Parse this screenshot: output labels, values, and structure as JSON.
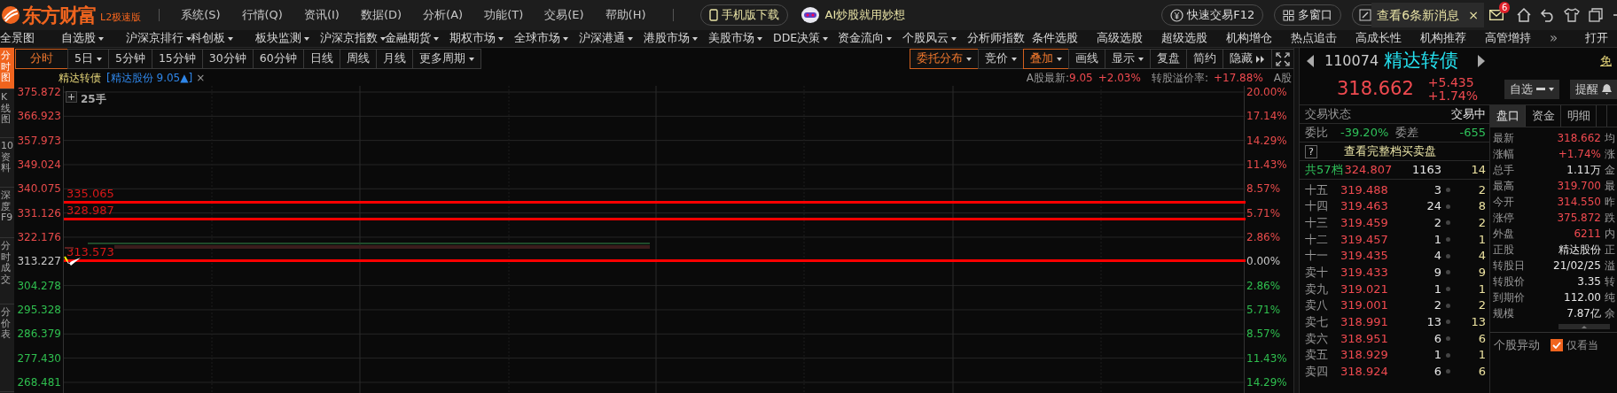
{
  "app": {
    "logo": "东方财富",
    "edition": "L2极速版"
  },
  "menu": [
    "系统(S)",
    "行情(Q)",
    "资讯(I)",
    "数据(D)",
    "分析(A)",
    "功能(T)",
    "交易(E)",
    "帮助(H)"
  ],
  "promo": {
    "download": "手机版下载",
    "ai": "AI炒股就用妙想"
  },
  "toolbar": {
    "quick_trade": "快速交易F12",
    "multi_window": "多窗口",
    "messages": "查看6条新消息",
    "close": "×",
    "mail_badge": "6"
  },
  "nav": [
    {
      "label": "全景图",
      "dropdown": false
    },
    {
      "label": "自选股",
      "dropdown": true
    },
    {
      "label": "沪深京排行",
      "dropdown": true
    },
    {
      "label": "科创板",
      "dropdown": true
    },
    {
      "label": "板块监测",
      "dropdown": true
    },
    {
      "label": "沪深京指数",
      "dropdown": true
    },
    {
      "label": "金融期货",
      "dropdown": true
    },
    {
      "label": "期权市场",
      "dropdown": true
    },
    {
      "label": "全球市场",
      "dropdown": true
    },
    {
      "label": "沪深港通",
      "dropdown": true
    },
    {
      "label": "港股市场",
      "dropdown": true
    },
    {
      "label": "美股市场",
      "dropdown": true
    },
    {
      "label": "DDE决策",
      "dropdown": true
    },
    {
      "label": "资金流向",
      "dropdown": true
    },
    {
      "label": "个股风云",
      "dropdown": true
    },
    {
      "label": "分析师指数",
      "dropdown": false
    },
    {
      "label": "条件选股",
      "dropdown": false
    },
    {
      "label": "高级选股",
      "dropdown": false
    },
    {
      "label": "超级选股",
      "dropdown": false
    },
    {
      "label": "机构增仓",
      "dropdown": false
    },
    {
      "label": "热点追击",
      "dropdown": false
    },
    {
      "label": "高成长性",
      "dropdown": false
    },
    {
      "label": "机构推荐",
      "dropdown": false
    },
    {
      "label": "高管增持",
      "dropdown": false
    }
  ],
  "nav_more": "»",
  "nav_right": "打开",
  "side_tabs": [
    {
      "label": "分时图",
      "selected": true
    },
    {
      "label": "K线图",
      "selected": false
    },
    {
      "label": "10资料",
      "selected": false
    },
    {
      "label": "深度F9",
      "selected": false
    },
    {
      "label": "分时成交",
      "selected": false
    },
    {
      "label": "分价表",
      "selected": false
    }
  ],
  "periods": [
    {
      "label": "分时",
      "selected": true,
      "dropdown": false
    },
    {
      "label": "5日",
      "selected": false,
      "dropdown": true
    },
    {
      "label": "5分钟",
      "selected": false,
      "dropdown": false
    },
    {
      "label": "15分钟",
      "selected": false,
      "dropdown": false
    },
    {
      "label": "30分钟",
      "selected": false,
      "dropdown": false
    },
    {
      "label": "60分钟",
      "selected": false,
      "dropdown": false
    },
    {
      "label": "日线",
      "selected": false,
      "dropdown": false
    },
    {
      "label": "周线",
      "selected": false,
      "dropdown": false
    },
    {
      "label": "月线",
      "selected": false,
      "dropdown": false
    },
    {
      "label": "更多周期",
      "selected": false,
      "dropdown": true
    }
  ],
  "tools": [
    {
      "label": "委托分布",
      "on": true,
      "dropdown": true
    },
    {
      "label": "竞价",
      "on": false,
      "dropdown": true
    },
    {
      "label": "叠加",
      "on": true,
      "dropdown": true
    },
    {
      "label": "画线",
      "on": false,
      "dropdown": false
    },
    {
      "label": "显示",
      "on": false,
      "dropdown": true
    },
    {
      "label": "复盘",
      "on": false,
      "dropdown": false
    },
    {
      "label": "简约",
      "on": false,
      "dropdown": false
    },
    {
      "label": "隐藏",
      "on": false,
      "dropdown": false,
      "kind": "hide"
    }
  ],
  "chart_header": {
    "name": "精达转债",
    "stock": "[精达股份 9.05▲]",
    "close": "×",
    "a_label": "A股最新:",
    "a_price": "9.05",
    "a_change": "+2.03%",
    "premium_label": "转股溢价率:",
    "premium": "+17.88%",
    "tail": "A股"
  },
  "volume_label": "25手",
  "axis_left": [
    {
      "label": "375.872",
      "kind": "up"
    },
    {
      "label": "366.923",
      "kind": "up"
    },
    {
      "label": "357.973",
      "kind": "up"
    },
    {
      "label": "349.024",
      "kind": "up"
    },
    {
      "label": "340.075",
      "kind": "up"
    },
    {
      "label": "331.126",
      "kind": "up"
    },
    {
      "label": "322.176",
      "kind": "up"
    },
    {
      "label": "313.227",
      "kind": "flat"
    },
    {
      "label": "304.278",
      "kind": "down"
    },
    {
      "label": "295.328",
      "kind": "down"
    },
    {
      "label": "286.379",
      "kind": "down"
    },
    {
      "label": "277.430",
      "kind": "down"
    },
    {
      "label": "268.481",
      "kind": "down"
    }
  ],
  "axis_right": [
    {
      "label": "20.00%",
      "kind": "up"
    },
    {
      "label": "17.14%",
      "kind": "up"
    },
    {
      "label": "14.29%",
      "kind": "up"
    },
    {
      "label": "11.43%",
      "kind": "up"
    },
    {
      "label": "8.57%",
      "kind": "up"
    },
    {
      "label": "5.71%",
      "kind": "up"
    },
    {
      "label": "2.86%",
      "kind": "up"
    },
    {
      "label": "0.00%",
      "kind": "flat"
    },
    {
      "label": "2.86%",
      "kind": "down"
    },
    {
      "label": "5.71%",
      "kind": "down"
    },
    {
      "label": "8.57%",
      "kind": "down"
    },
    {
      "label": "11.43%",
      "kind": "down"
    },
    {
      "label": "14.29%",
      "kind": "down"
    }
  ],
  "price_lines": [
    {
      "label": "335.065"
    },
    {
      "label": "328.987"
    },
    {
      "label": "313.573"
    }
  ],
  "quote": {
    "code": "110074",
    "name": "精达转债",
    "price": "318.662",
    "change": "+5.435",
    "change_pct": "+1.74%",
    "free": "免",
    "watch": "自选",
    "alert": "提醒"
  },
  "book": {
    "status_label": "交易状态",
    "status": "交易中",
    "ratio_label": "委比",
    "ratio": "-39.20%",
    "diff_label": "委差",
    "diff": "-655",
    "help": "?",
    "full": "查看完整档买卖盘",
    "total_label": "共57档",
    "total_price": "324.807",
    "total_volume": "1163",
    "total_count": "14",
    "rows": [
      {
        "tier": "十五",
        "price": "319.488",
        "volume": "3",
        "count": "2"
      },
      {
        "tier": "十四",
        "price": "319.463",
        "volume": "24",
        "count": "8"
      },
      {
        "tier": "十三",
        "price": "319.459",
        "volume": "2",
        "count": "2"
      },
      {
        "tier": "十二",
        "price": "319.457",
        "volume": "1",
        "count": "1"
      },
      {
        "tier": "十一",
        "price": "319.435",
        "volume": "4",
        "count": "4"
      },
      {
        "tier": "卖十",
        "price": "319.433",
        "volume": "9",
        "count": "9"
      },
      {
        "tier": "卖九",
        "price": "319.021",
        "volume": "1",
        "count": "1"
      },
      {
        "tier": "卖八",
        "price": "319.001",
        "volume": "2",
        "count": "2"
      },
      {
        "tier": "卖七",
        "price": "318.991",
        "volume": "13",
        "count": "13"
      },
      {
        "tier": "卖六",
        "price": "318.951",
        "volume": "6",
        "count": "6"
      },
      {
        "tier": "卖五",
        "price": "318.929",
        "volume": "1",
        "count": "1"
      },
      {
        "tier": "卖四",
        "price": "318.924",
        "volume": "6",
        "count": "6"
      }
    ]
  },
  "stats_tabs": [
    {
      "label": "盘口",
      "selected": true
    },
    {
      "label": "资金",
      "selected": false
    },
    {
      "label": "明细",
      "selected": false
    }
  ],
  "stats": [
    {
      "label": "最新",
      "value": "318.662",
      "kind": "up",
      "side": "均"
    },
    {
      "label": "涨幅",
      "value": "+1.74%",
      "kind": "up",
      "side": "涨"
    },
    {
      "label": "总手",
      "value": "1.11万",
      "kind": "plain",
      "side": "金"
    },
    {
      "label": "最高",
      "value": "319.700",
      "kind": "up",
      "side": "最"
    },
    {
      "label": "今开",
      "value": "314.550",
      "kind": "up",
      "side": "昨"
    },
    {
      "label": "涨停",
      "value": "375.872",
      "kind": "up",
      "side": "跌"
    },
    {
      "label": "外盘",
      "value": "6211",
      "kind": "up",
      "side": "内"
    },
    {
      "label": "正股",
      "value": "精达股份",
      "kind": "plain",
      "side": "正"
    },
    {
      "label": "转股日",
      "value": "21/02/25",
      "kind": "plain",
      "side": "溢"
    },
    {
      "label": "转股价",
      "value": "3.35",
      "kind": "plain",
      "side": "转"
    },
    {
      "label": "到期价",
      "value": "112.00",
      "kind": "plain",
      "side": "纯"
    },
    {
      "label": "规模",
      "value": "7.87亿",
      "kind": "plain",
      "side": "余"
    }
  ],
  "alerts": {
    "title": "个股异动",
    "filter": {
      "label": "仅看当",
      "checked": true
    }
  }
}
